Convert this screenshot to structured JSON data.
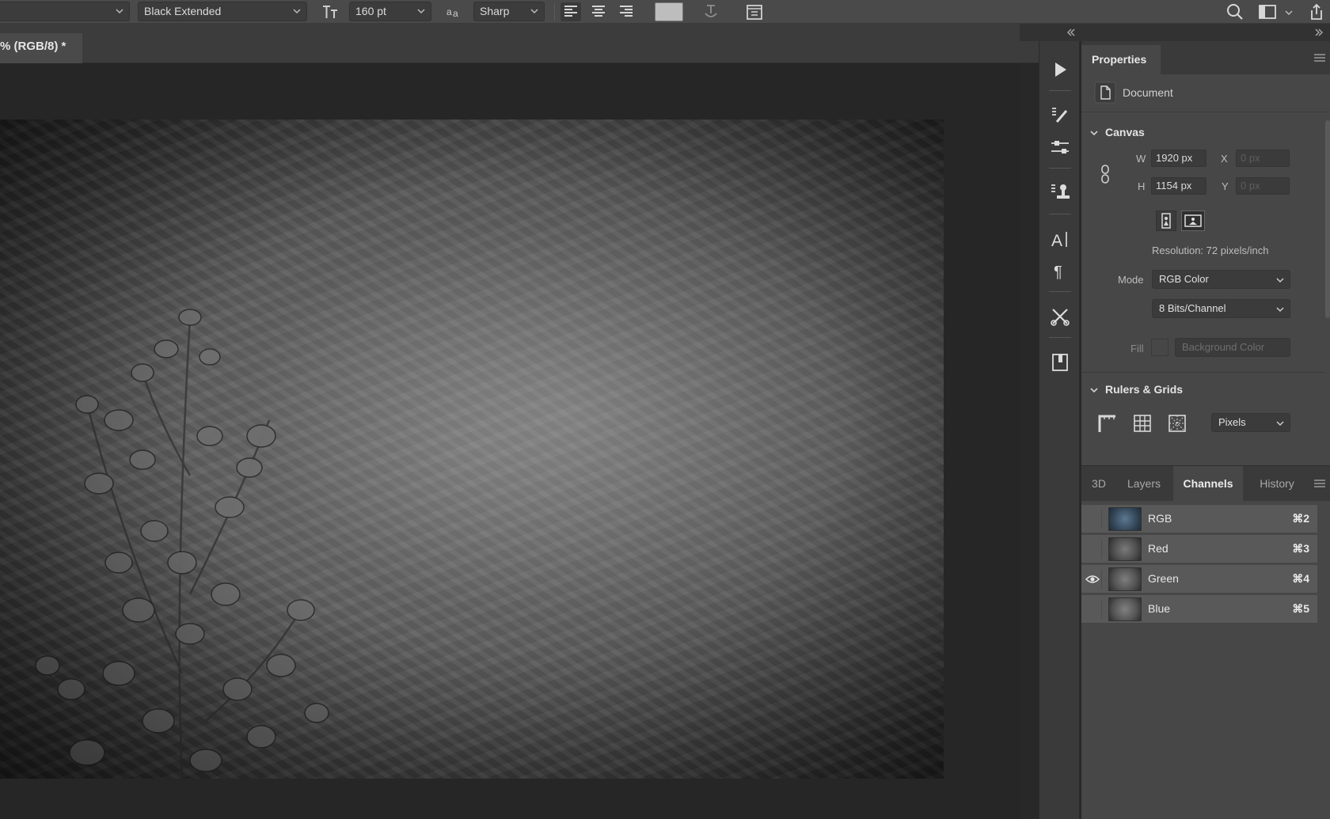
{
  "options_bar": {
    "font_style": "Black Extended",
    "font_size": "160 pt",
    "antialias": "Sharp"
  },
  "document_tab": {
    "title": "% (RGB/8) *"
  },
  "properties": {
    "tab_label": "Properties",
    "doc_label": "Document",
    "canvas": {
      "heading": "Canvas",
      "w_label": "W",
      "w_value": "1920 px",
      "h_label": "H",
      "h_value": "1154 px",
      "x_label": "X",
      "x_value": "0 px",
      "y_label": "Y",
      "y_value": "0 px",
      "resolution": "Resolution: 72 pixels/inch",
      "mode_label": "Mode",
      "mode_value": "RGB Color",
      "depth_value": "8 Bits/Channel",
      "fill_label": "Fill",
      "fill_value": "Background Color"
    },
    "rulers": {
      "heading": "Rulers & Grids",
      "units": "Pixels"
    }
  },
  "channels_panel": {
    "tabs": [
      {
        "label": "3D",
        "active": false
      },
      {
        "label": "Layers",
        "active": false
      },
      {
        "label": "Channels",
        "active": true
      },
      {
        "label": "History",
        "active": false
      }
    ],
    "rows": [
      {
        "name": "RGB",
        "key": "⌘2",
        "visible": false
      },
      {
        "name": "Red",
        "key": "⌘3",
        "visible": false
      },
      {
        "name": "Green",
        "key": "⌘4",
        "visible": true
      },
      {
        "name": "Blue",
        "key": "⌘5",
        "visible": false
      }
    ]
  },
  "colors": {
    "panel_bg": "#474747",
    "row_bg": "#595959",
    "workspace_bg": "#262626"
  }
}
